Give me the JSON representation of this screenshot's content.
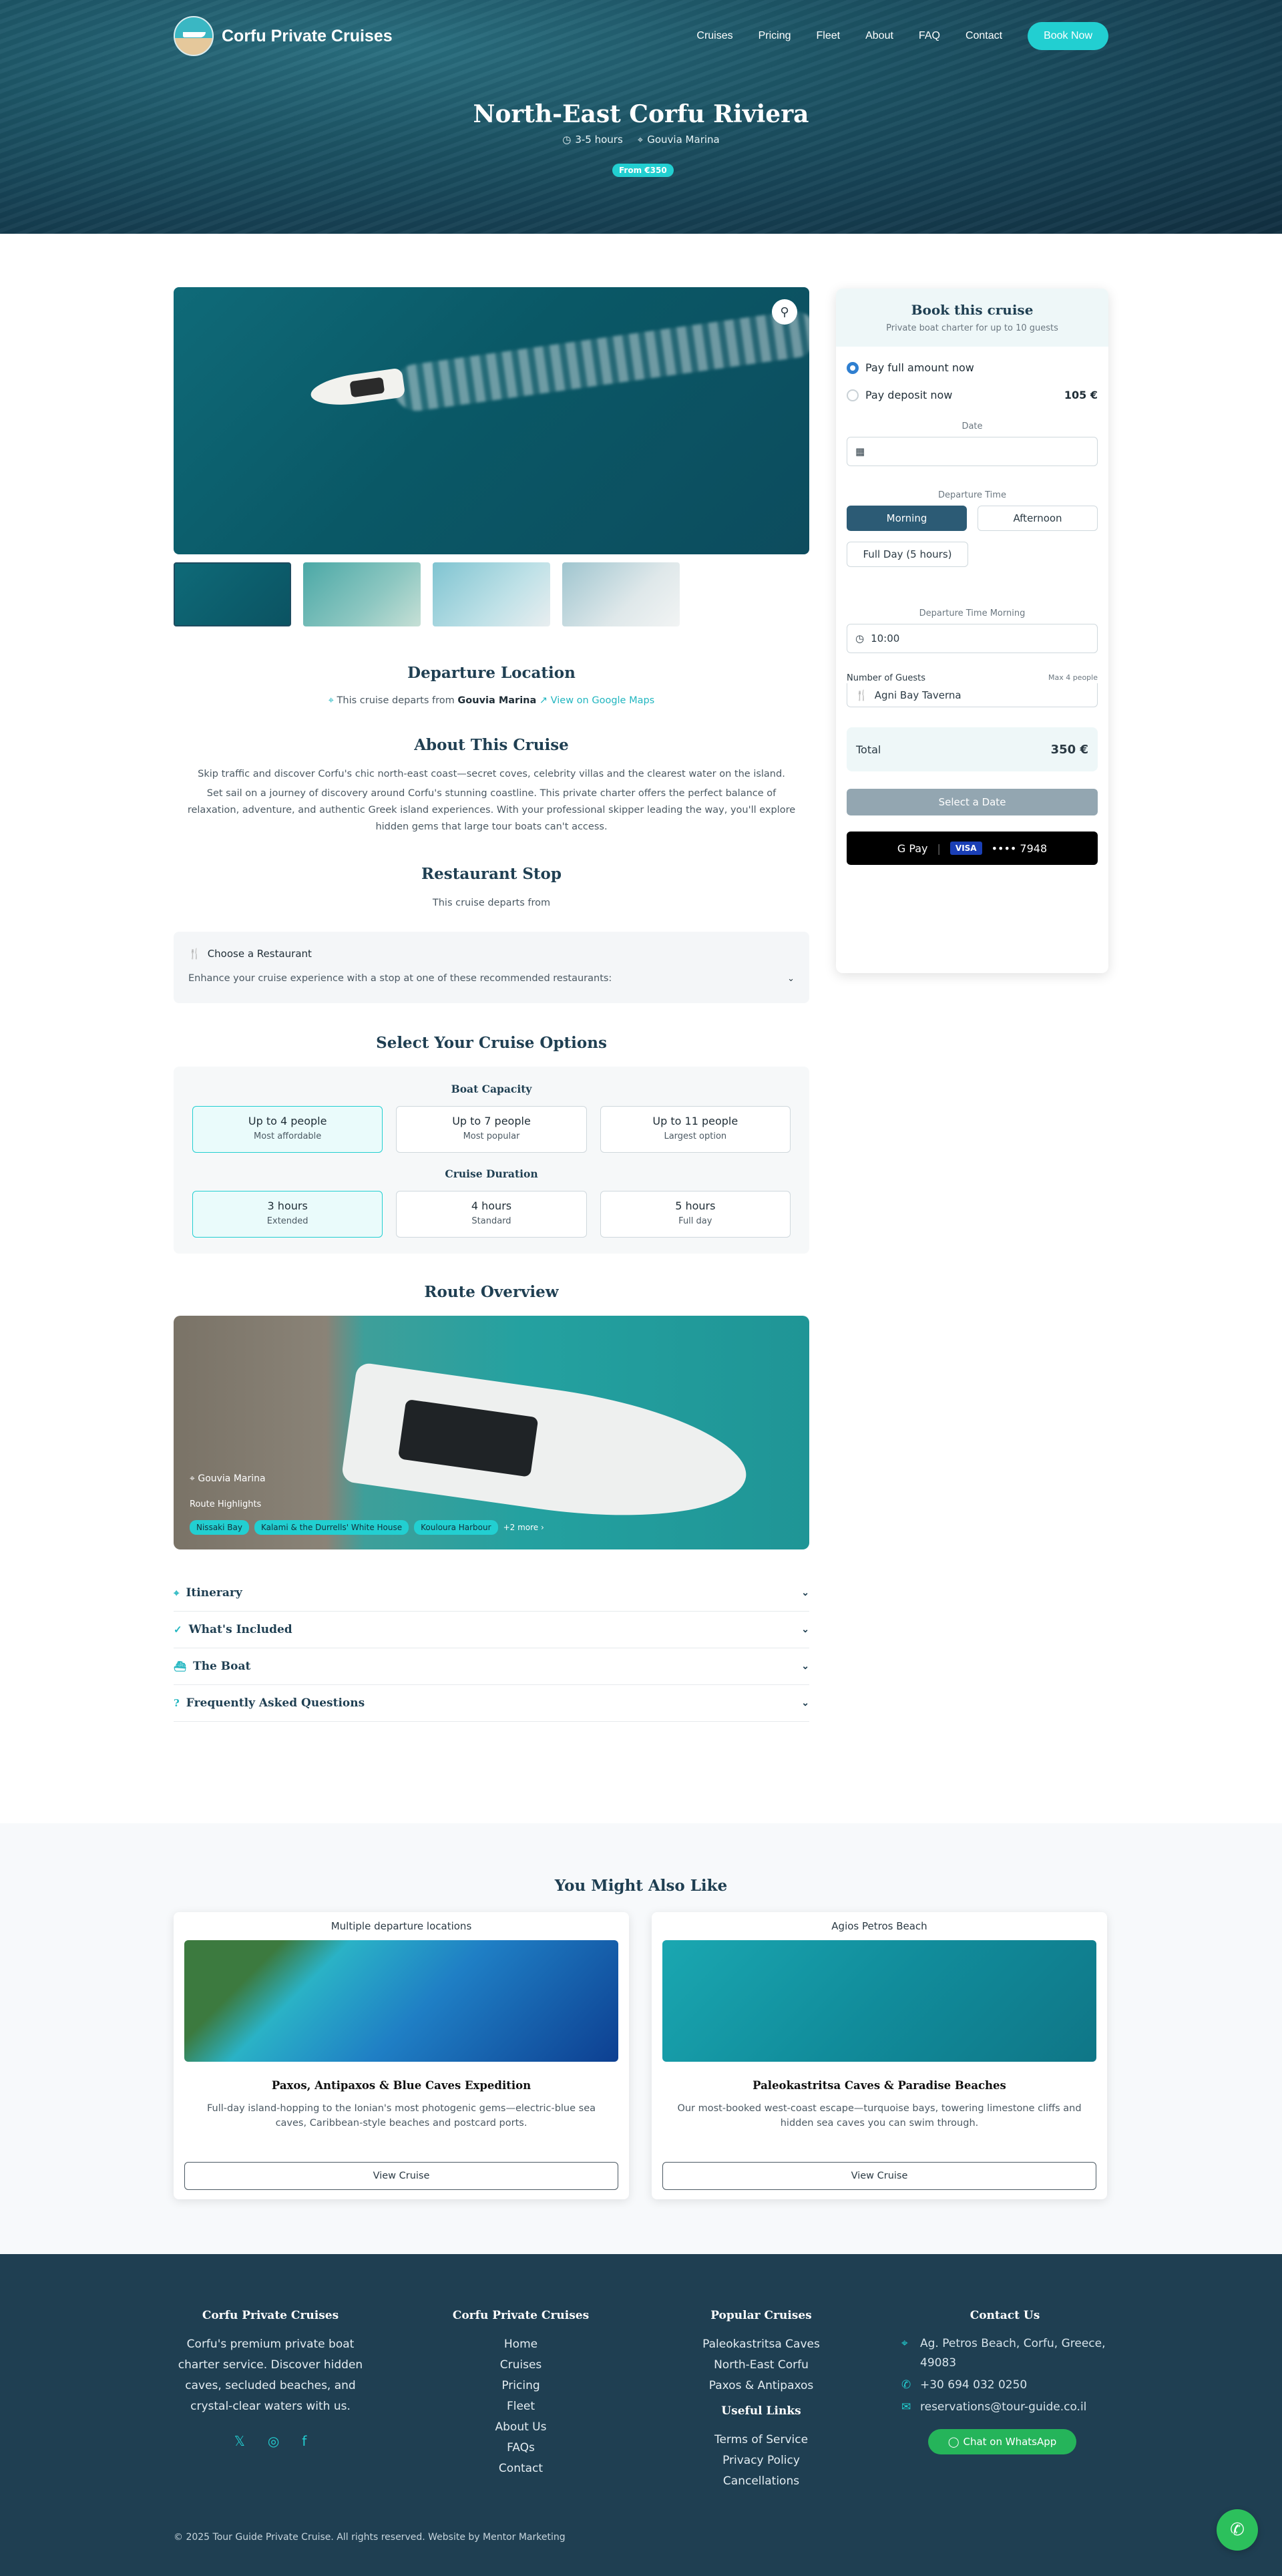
{
  "header": {
    "brand": "Corfu Private Cruises",
    "nav": [
      "Cruises",
      "Pricing",
      "Fleet",
      "About",
      "FAQ",
      "Contact"
    ],
    "book_button": "Book Now"
  },
  "hero": {
    "title": "North-East Corfu Riviera",
    "duration": "3-5 hours",
    "location": "Gouvia Marina",
    "price_badge": "From €350"
  },
  "departure": {
    "title": "Departure Location",
    "text_prefix": "This cruise departs from",
    "marina": "Gouvia Marina",
    "maps_link": "View on Google Maps"
  },
  "about": {
    "title": "About This Cruise",
    "p1": "Skip traffic and discover Corfu's chic north-east coast—secret coves, celebrity villas and the clearest water on the island.",
    "p2": "Set sail on a journey of discovery around Corfu's stunning coastline. This private charter offers the perfect balance of relaxation, adventure, and authentic Greek island experiences. With your professional skipper leading the way, you'll explore hidden gems that large tour boats can't access."
  },
  "restaurant": {
    "title": "Restaurant Stop",
    "subtitle": "This cruise departs from",
    "choose": "Choose a Restaurant",
    "desc": "Enhance your cruise experience with a stop at one of these recommended restaurants:"
  },
  "options": {
    "title": "Select Your Cruise Options",
    "capacity_title": "Boat Capacity",
    "capacity": [
      {
        "label": "Up to 4 people",
        "sub": "Most affordable"
      },
      {
        "label": "Up to 7 people",
        "sub": "Most popular"
      },
      {
        "label": "Up to 11 people",
        "sub": "Largest option"
      }
    ],
    "duration_title": "Cruise Duration",
    "duration": [
      {
        "label": "3 hours",
        "sub": "Extended"
      },
      {
        "label": "4 hours",
        "sub": "Standard"
      },
      {
        "label": "5 hours",
        "sub": "Full day"
      }
    ]
  },
  "route": {
    "title": "Route Overview",
    "location": "Gouvia Marina",
    "highlights_label": "Route Highlights",
    "chips": [
      "Nissaki Bay",
      "Kalami & the Durrells' White House",
      "Kouloura Harbour"
    ],
    "more": "+2 more"
  },
  "accordion": [
    "Itinerary",
    "What's Included",
    "The Boat",
    "Frequently Asked Questions"
  ],
  "booking": {
    "title": "Book this cruise",
    "subtitle": "Private boat charter for up to 10 guests",
    "pay_full": "Pay full amount now",
    "pay_deposit": "Pay deposit now",
    "deposit_amount": "105 €",
    "date_label": "Date",
    "time_label": "Departure Time",
    "morning": "Morning",
    "afternoon": "Afternoon",
    "fullday": "Full Day (5 hours)",
    "time_morning_label": "Departure Time Morning",
    "time_value": "10:00",
    "guests_label": "Number of Guests",
    "guests_max": "Max 4 people",
    "restaurant_value": "Agni Bay Taverna",
    "total_label": "Total",
    "total_value": "350 €",
    "select_date": "Select a Date",
    "gpay": "G Pay",
    "card_brand": "VISA",
    "card_digits": "•••• 7948"
  },
  "also": {
    "title": "You Might Also Like",
    "cards": [
      {
        "top": "Multiple departure locations",
        "title": "Paxos, Antipaxos & Blue Caves Expedition",
        "desc": "Full-day island-hopping to the Ionian's most photogenic gems—electric-blue sea caves, Caribbean-style beaches and postcard ports.",
        "button": "View Cruise"
      },
      {
        "top": "Agios Petros Beach",
        "title": "Paleokastritsa Caves & Paradise Beaches",
        "desc": "Our most-booked west-coast escape—turquoise bays, towering limestone cliffs and hidden sea caves you can swim through.",
        "button": "View Cruise"
      }
    ]
  },
  "footer": {
    "col1_title": "Corfu Private Cruises",
    "col1_text": "Corfu's premium private boat charter service. Discover hidden caves, secluded beaches, and crystal-clear waters with us.",
    "col2_title": "Corfu Private Cruises",
    "col2_links": [
      "Home",
      "Cruises",
      "Pricing",
      "Fleet",
      "About Us",
      "FAQs",
      "Contact"
    ],
    "col3_title": "Popular Cruises",
    "col3_links": [
      "Paleokastritsa Caves",
      "North-East Corfu",
      "Paxos & Antipaxos"
    ],
    "col3b_title": "Useful Links",
    "col3b_links": [
      "Terms of Service",
      "Privacy Policy",
      "Cancellations"
    ],
    "col4_title": "Contact Us",
    "address": "Ag. Petros Beach, Corfu, Greece, 49083",
    "phone": "+30 694 032 0250",
    "email": "reservations@tour-guide.co.il",
    "whatsapp": "Chat on WhatsApp",
    "copyright": "© 2025 Tour Guide Private Cruise. All rights reserved. Website by Mentor Marketing"
  },
  "colors": {
    "accent": "#22cfd1",
    "dark": "#1f3f52",
    "whatsapp": "#25b45a"
  }
}
